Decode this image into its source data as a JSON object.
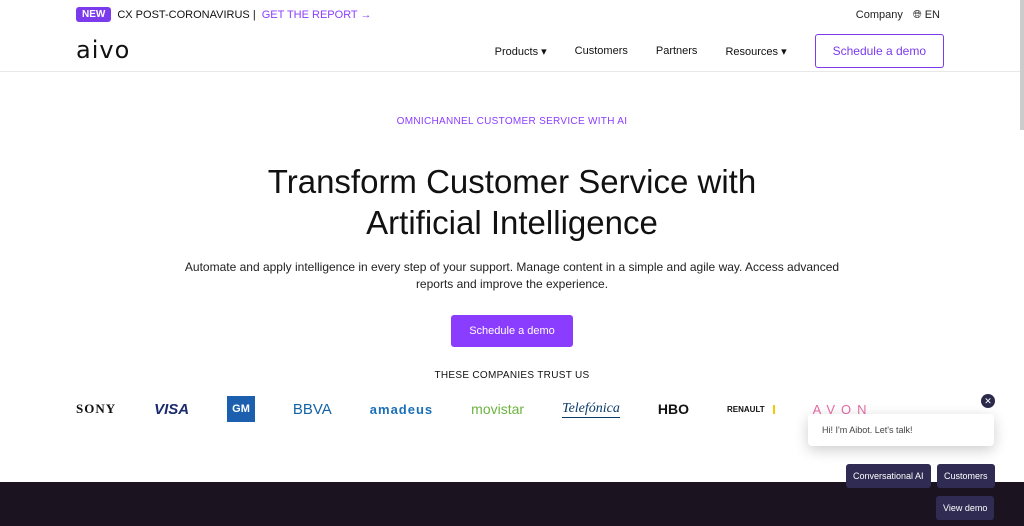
{
  "promo": {
    "badge": "NEW",
    "text": "CX POST-CORONAVIRUS |",
    "link": "GET THE REPORT →"
  },
  "util": {
    "company": "Company",
    "lang": "EN"
  },
  "logo": "aivo",
  "nav": [
    {
      "label": "Products ▾"
    },
    {
      "label": "Customers"
    },
    {
      "label": "Partners"
    },
    {
      "label": "Resources ▾"
    }
  ],
  "nav_cta": "Schedule a demo",
  "hero": {
    "eyebrow": "OMNICHANNEL CUSTOMER SERVICE WITH AI",
    "title1": "Transform Customer Service with",
    "title2": "Artificial Intelligence",
    "subtitle": "Automate and apply intelligence in every step of your support. Manage content in a simple and agile way. Access advanced reports and improve the experience.",
    "cta": "Schedule a demo"
  },
  "trust": "THESE COMPANIES TRUST US",
  "logos": [
    "SONY",
    "VISA",
    "GM",
    "BBVA",
    "amadeus",
    "movistar",
    "Telefónica",
    "HBO",
    "RENAULT",
    "AVON"
  ],
  "chat": {
    "message": "Hi! I'm Aibot. Let's talk!",
    "replies": [
      "Conversational AI",
      "Customers",
      "View demo"
    ]
  },
  "colors": {
    "accent": "#8b3dff",
    "dark": "#1b1420",
    "chip": "#2f2b52"
  }
}
